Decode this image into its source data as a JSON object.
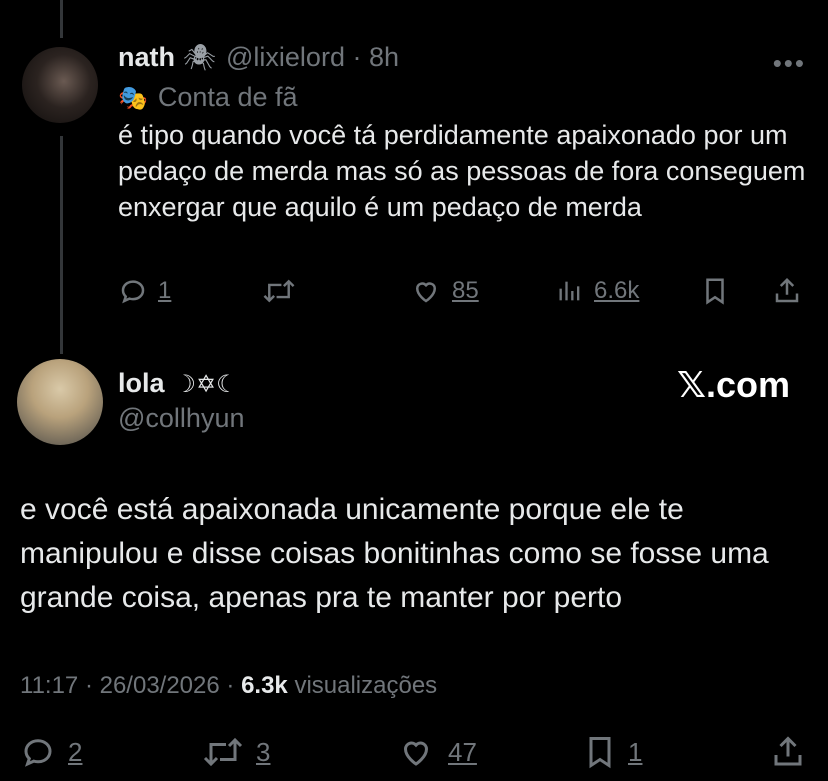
{
  "reply": {
    "author_name": "nath",
    "author_emoji": "🕷",
    "handle_time": "@lixielord · 8h",
    "badge_icon": "theater-mask-icon",
    "badge_label": "Conta de fã",
    "text": "é tipo quando você tá perdidamente apaixonado por um pedaço de merda mas só as pessoas de fora conseguem enxergar que aquilo é um pedaço de merda",
    "more_label": "•••",
    "replies": "1",
    "likes": "85",
    "views": "6.6k"
  },
  "main": {
    "author_name": "lola",
    "author_symbols": "☽✡☾",
    "handle": "@collhyun",
    "brand": "𝕏.com",
    "text": "e você está apaixonada unicamente porque ele te manipulou e disse coisas bonitinhas como se fosse uma grande coisa, apenas pra te manter por perto",
    "time_date": "11:17 · 26/03/2026 · ",
    "views_count": "6.3k",
    "views_label": " visualizações",
    "replies": "2",
    "retweets": "3",
    "likes": "47",
    "bookmarks": "1"
  },
  "colors": {
    "background": "#000000",
    "text": "#e7e9ea",
    "muted": "#71767b"
  }
}
